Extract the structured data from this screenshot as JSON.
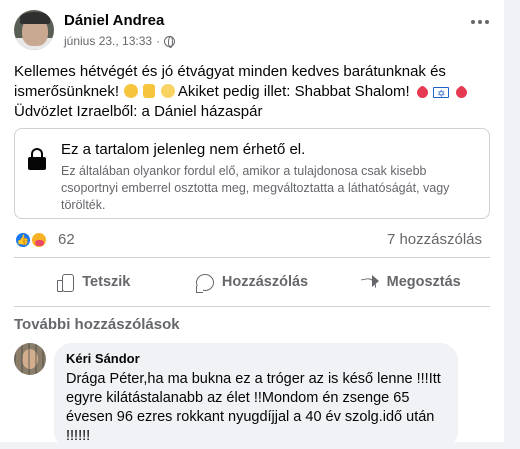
{
  "post": {
    "author": "Dániel Andrea",
    "timestamp": "június 23., 13:33",
    "separator": "·",
    "privacy_icon": "globe-icon",
    "text_lines": [
      "Kellemes hétvégét és jó étvágyat minden kedves barátunknak és",
      "ismerősünknek!",
      "Akiket pedig illet: Shabbat Shalom!",
      "Üdvözlet Izraelből: a Dániel házaspár"
    ]
  },
  "shared_content": {
    "title": "Ez a tartalom jelenleg nem érhető el.",
    "description": "Ez általában olyankor fordul elő, amikor a tulajdonosa csak kisebb csoportnyi emberrel osztotta meg, megváltoztatta a láthatóságát, vagy törölték.",
    "icon": "lock-icon"
  },
  "engagement": {
    "reaction_count": "62",
    "comment_count": "7 hozzászólás",
    "reaction_icons": [
      "like-icon",
      "care-icon"
    ]
  },
  "actions": {
    "like": "Tetszik",
    "comment": "Hozzászólás",
    "share": "Megosztás"
  },
  "comments": {
    "more_label": "További hozzászólások",
    "items": [
      {
        "author": "Kéri Sándor",
        "text": "Drága Péter,ha ma bukna ez a tróger az is késő lenne !!!Itt egyre kilátástalanabb az élet !!Mondom én zsenge 65 évesen 96 ezres rokkant nyugdíjjal a 40 év szolg.idő után !!!!!!"
      }
    ]
  }
}
